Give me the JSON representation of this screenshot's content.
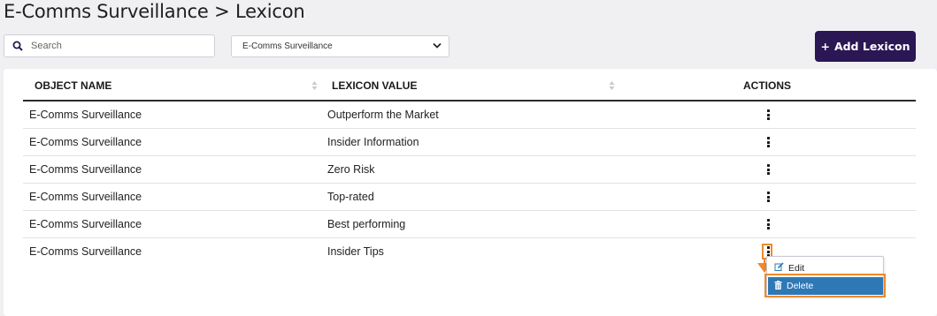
{
  "page": {
    "title": "E-Comms Surveillance > Lexicon"
  },
  "search": {
    "placeholder": "Search"
  },
  "filter": {
    "selected": "E-Comms Surveillance"
  },
  "toolbar": {
    "add_label": "Add Lexicon",
    "add_icon": "+"
  },
  "table": {
    "columns": [
      "OBJECT NAME",
      "LEXICON VALUE",
      "ACTIONS"
    ],
    "rows": [
      {
        "object_name": "E-Comms Surveillance",
        "lexicon_value": "Outperform the Market"
      },
      {
        "object_name": "E-Comms Surveillance",
        "lexicon_value": "Insider Information"
      },
      {
        "object_name": "E-Comms Surveillance",
        "lexicon_value": "Zero Risk"
      },
      {
        "object_name": "E-Comms Surveillance",
        "lexicon_value": "Top-rated"
      },
      {
        "object_name": "E-Comms Surveillance",
        "lexicon_value": "Best performing"
      },
      {
        "object_name": "E-Comms Surveillance",
        "lexicon_value": "Insider Tips"
      }
    ]
  },
  "actions_menu": {
    "edit_label": "Edit",
    "delete_label": "Delete",
    "edit_icon": "pencil-square-icon",
    "delete_icon": "trash-icon"
  },
  "colors": {
    "primary_button": "#2b1754",
    "menu_active": "#2f78b6",
    "annotation": "#f08a2b"
  }
}
